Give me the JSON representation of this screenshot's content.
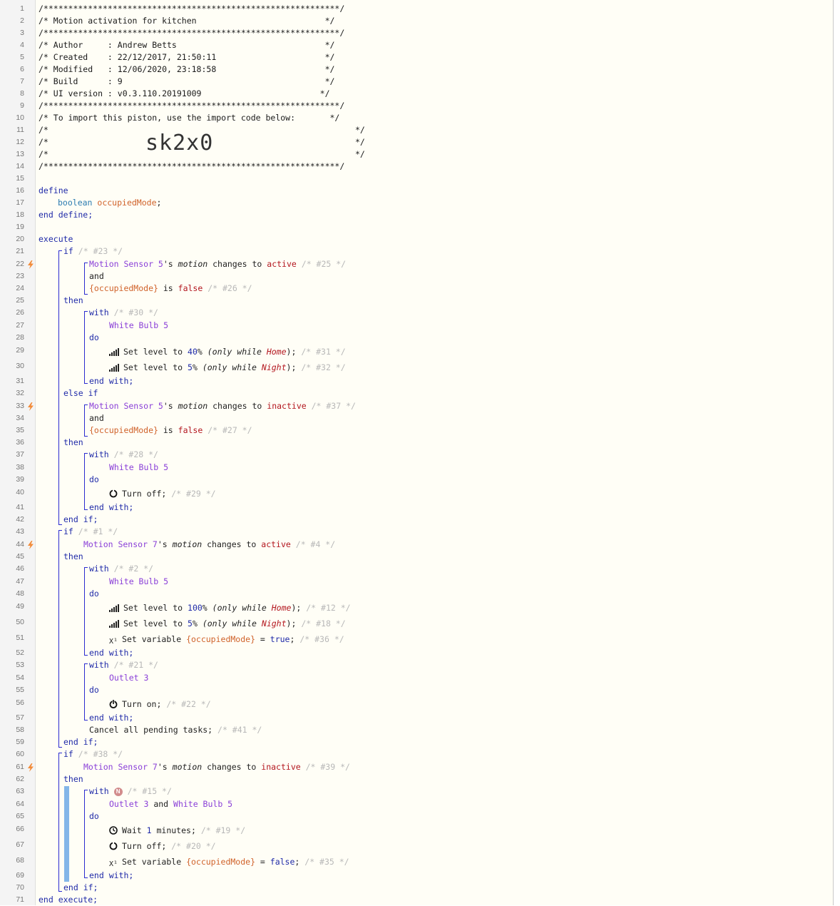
{
  "header": {
    "stars": "/************************************************************/",
    "title": "/* Motion activation for kitchen                          */",
    "author": "/* Author     : Andrew Betts                              */",
    "created": "/* Created    : 22/12/2017, 21:50:11                      */",
    "modified": "/* Modified   : 12/06/2020, 23:18:58                      */",
    "build": "/* Build      : 9                                         */",
    "ui_version": "/* UI version : v0.3.110.20191009                        */",
    "import_line": "/* To import this piston, use the import code below:       */",
    "blank_left": "/*",
    "blank_right": "*/",
    "import_code": "sk2x0"
  },
  "define": {
    "kw_define": "define",
    "type": "boolean",
    "var_name": "occupiedMode",
    "semi": ";",
    "end": "end define;"
  },
  "exec": {
    "execute": "execute",
    "end_execute": "end execute;"
  },
  "kw": {
    "if": "if",
    "then": "then",
    "else_if": "else if",
    "end_if": "end if;",
    "with": "with",
    "do": "do",
    "end_with": "end with;",
    "and": "and"
  },
  "tokens": {
    "motion_sensor_5": "Motion Sensor 5",
    "motion_sensor_7": "Motion Sensor 7",
    "s_motion_1": "'s ",
    "motion": "motion",
    "changes_to": " changes to ",
    "active": "active",
    "inactive": "inactive",
    "occupied_braced": "{occupiedMode}",
    "is": " is ",
    "false": "false",
    "true": "true",
    "white_bulb_5": "White Bulb 5",
    "outlet_3": "Outlet 3",
    "and_sep": " and ",
    "set_level_to": "Set level to ",
    "pct": "%",
    "only_while": " (only while ",
    "home": "Home",
    "night": "Night",
    "close": ");",
    "turn_off": "Turn off;",
    "turn_on": "Turn on;",
    "set_variable": "Set variable ",
    "equals": " = ",
    "semi": ";",
    "wait": "Wait ",
    "minutes": " minutes;",
    "cancel": "Cancel all pending tasks;",
    "n_badge": "N"
  },
  "values": {
    "level_40": "40",
    "level_5": "5",
    "level_100": "100",
    "wait_1": "1"
  },
  "ids": {
    "c23": "/* #23 */",
    "c25": "/* #25 */",
    "c26": "/* #26 */",
    "c30": "/* #30 */",
    "c31": "/* #31 */",
    "c32": "/* #32 */",
    "c37": "/* #37 */",
    "c27": "/* #27 */",
    "c28": "/* #28 */",
    "c29": "/* #29 */",
    "c1": "/* #1 */",
    "c4": "/* #4 */",
    "c2": "/* #2 */",
    "c12": "/* #12 */",
    "c18": "/* #18 */",
    "c36": "/* #36 */",
    "c21": "/* #21 */",
    "c22": "/* #22 */",
    "c41": "/* #41 */",
    "c38": "/* #38 */",
    "c39": "/* #39 */",
    "c15": "/* #15 */",
    "c19": "/* #19 */",
    "c20": "/* #20 */",
    "c35": "/* #35 */"
  },
  "line_numbers": [
    "1",
    "2",
    "3",
    "4",
    "5",
    "6",
    "7",
    "8",
    "9",
    "10",
    "11",
    "12",
    "13",
    "14",
    "15",
    "16",
    "17",
    "18",
    "19",
    "20",
    "21",
    "22",
    "23",
    "24",
    "25",
    "26",
    "27",
    "28",
    "29",
    "30",
    "31",
    "32",
    "33",
    "34",
    "35",
    "36",
    "37",
    "38",
    "39",
    "40",
    "41",
    "42",
    "43",
    "44",
    "45",
    "46",
    "47",
    "48",
    "49",
    "50",
    "51",
    "52",
    "53",
    "54",
    "55",
    "56",
    "57",
    "58",
    "59",
    "60",
    "61",
    "62",
    "63",
    "64",
    "65",
    "66",
    "67",
    "68",
    "69",
    "70",
    "71"
  ],
  "colors": {
    "keyword": "#1f2aa8",
    "device": "#8a3fd8",
    "variable": "#d0622a",
    "value": "#b3161e",
    "trigger_bolt": "#f28c3a",
    "timer_bar": "#83b6e8"
  },
  "icons": [
    "lightning-bolt-icon",
    "signal-level-icon",
    "power-off-icon",
    "power-on-icon",
    "variable-icon",
    "clock-icon"
  ]
}
